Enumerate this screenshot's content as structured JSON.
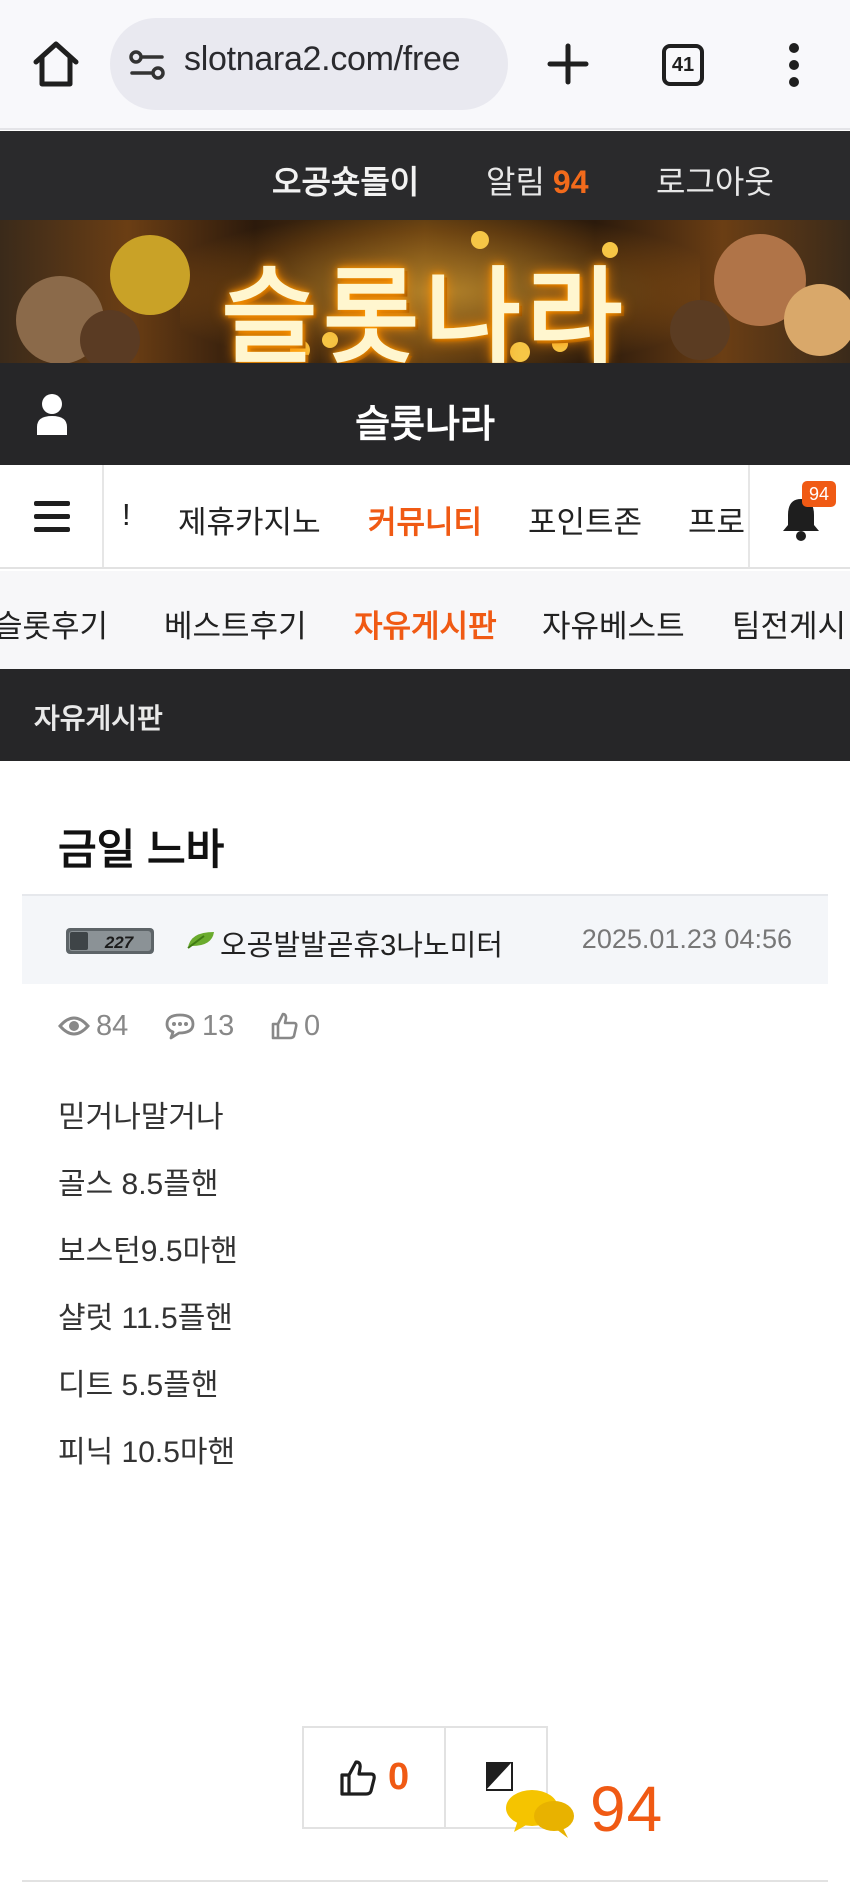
{
  "browser": {
    "url": "slotnara2.com/free",
    "tab_count": "41"
  },
  "user_bar": {
    "nickname": "오공숏돌이",
    "alarm_label": "알림",
    "alarm_count": "94",
    "logout": "로그아웃"
  },
  "banner": {
    "title": "슬롯나라"
  },
  "site": {
    "title": "슬롯나라"
  },
  "main_nav": {
    "items": [
      "!",
      "제휴카지노",
      "커뮤니티",
      "포인트존",
      "프로"
    ],
    "active": "커뮤니티",
    "notification_badge": "94"
  },
  "sub_nav": {
    "items": [
      "슬롯후기",
      "베스트후기",
      "자유게시판",
      "자유베스트",
      "팀전게시"
    ],
    "active": "자유게시판"
  },
  "board": {
    "title": "자유게시판"
  },
  "post": {
    "title": "금일 느바",
    "author_level": "227",
    "author": "오공발발곧휴3나노미터",
    "date": "2025.01.23 04:56",
    "views": "84",
    "comments": "13",
    "likes": "0",
    "body": [
      "믿거나말거나",
      "골스 8.5플핸",
      "보스턴9.5마핸",
      "샬럿 11.5플핸",
      "디트 5.5플핸",
      "피닉 10.5마핸"
    ]
  },
  "actions": {
    "like_count": "0",
    "floating_count": "94"
  },
  "colors": {
    "accent": "#f05a14",
    "dark_bar": "#262628",
    "chat_bubble": "#f5c400"
  }
}
